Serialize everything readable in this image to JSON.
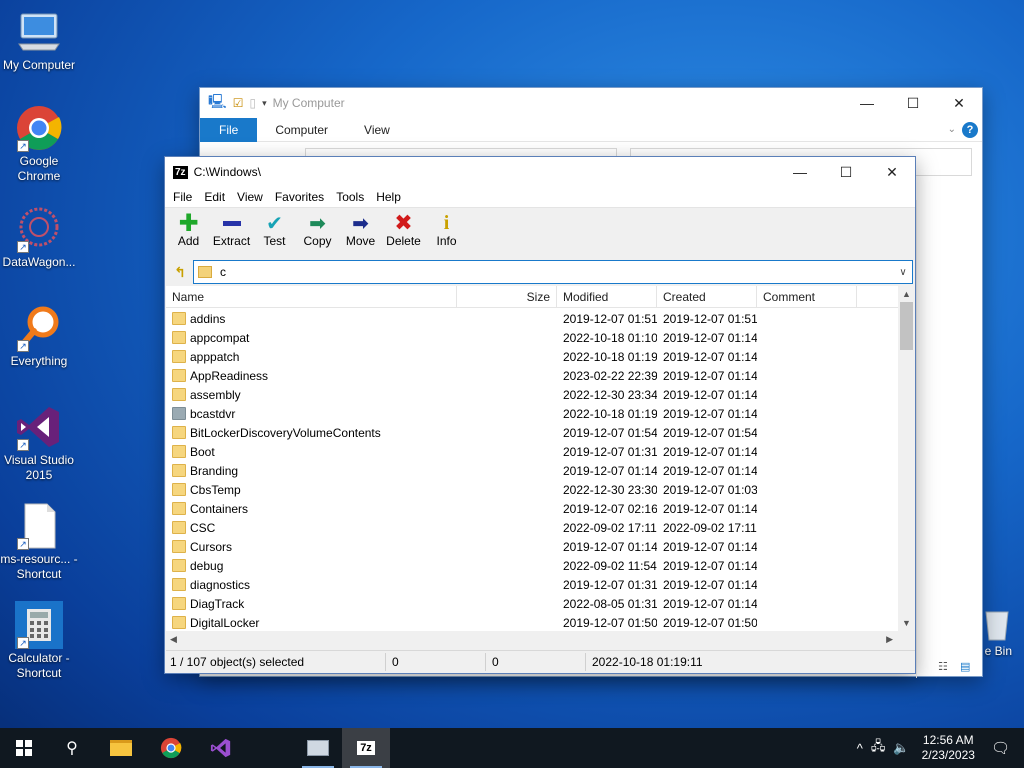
{
  "desktop": {
    "icons": [
      {
        "label": "My Computer"
      },
      {
        "label": "Google Chrome"
      },
      {
        "label": "DataWagon..."
      },
      {
        "label": "Everything"
      },
      {
        "label": "Visual Studio 2015"
      },
      {
        "label": "ms-resourc... - Shortcut"
      },
      {
        "label": "Calculator - Shortcut"
      },
      {
        "label": "e Bin"
      }
    ]
  },
  "explorer": {
    "title": "My Computer",
    "ribbon_tabs": [
      "File",
      "Computer",
      "View"
    ]
  },
  "sevenzip": {
    "title_icon": "7z",
    "title": "C:\\Windows\\",
    "menu": [
      "File",
      "Edit",
      "View",
      "Favorites",
      "Tools",
      "Help"
    ],
    "toolbar": [
      "Add",
      "Extract",
      "Test",
      "Copy",
      "Move",
      "Delete",
      "Info"
    ],
    "address": "c",
    "columns": {
      "name": "Name",
      "size": "Size",
      "modified": "Modified",
      "created": "Created",
      "comment": "Comment"
    },
    "rows": [
      {
        "name": "addins",
        "modified": "2019-12-07 01:51",
        "created": "2019-12-07 01:51"
      },
      {
        "name": "appcompat",
        "modified": "2022-10-18 01:10",
        "created": "2019-12-07 01:14"
      },
      {
        "name": "apppatch",
        "modified": "2022-10-18 01:19",
        "created": "2019-12-07 01:14"
      },
      {
        "name": "AppReadiness",
        "modified": "2023-02-22 22:39",
        "created": "2019-12-07 01:14"
      },
      {
        "name": "assembly",
        "modified": "2022-12-30 23:34",
        "created": "2019-12-07 01:14"
      },
      {
        "name": "bcastdvr",
        "modified": "2022-10-18 01:19",
        "created": "2019-12-07 01:14"
      },
      {
        "name": "BitLockerDiscoveryVolumeContents",
        "modified": "2019-12-07 01:54",
        "created": "2019-12-07 01:54"
      },
      {
        "name": "Boot",
        "modified": "2019-12-07 01:31",
        "created": "2019-12-07 01:14"
      },
      {
        "name": "Branding",
        "modified": "2019-12-07 01:14",
        "created": "2019-12-07 01:14"
      },
      {
        "name": "CbsTemp",
        "modified": "2022-12-30 23:30",
        "created": "2019-12-07 01:03"
      },
      {
        "name": "Containers",
        "modified": "2019-12-07 02:16",
        "created": "2019-12-07 01:14"
      },
      {
        "name": "CSC",
        "modified": "2022-09-02 17:11",
        "created": "2022-09-02 17:11"
      },
      {
        "name": "Cursors",
        "modified": "2019-12-07 01:14",
        "created": "2019-12-07 01:14"
      },
      {
        "name": "debug",
        "modified": "2022-09-02 11:54",
        "created": "2019-12-07 01:14"
      },
      {
        "name": "diagnostics",
        "modified": "2019-12-07 01:31",
        "created": "2019-12-07 01:14"
      },
      {
        "name": "DiagTrack",
        "modified": "2022-08-05 01:31",
        "created": "2019-12-07 01:14"
      },
      {
        "name": "DigitalLocker",
        "modified": "2019-12-07 01:50",
        "created": "2019-12-07 01:50"
      }
    ],
    "status": {
      "selected": "1 / 107 object(s) selected",
      "size": "0",
      "packed": "0",
      "date": "2022-10-18 01:19:11"
    }
  },
  "taskbar": {
    "time": "12:56 AM",
    "date": "2/23/2023"
  }
}
